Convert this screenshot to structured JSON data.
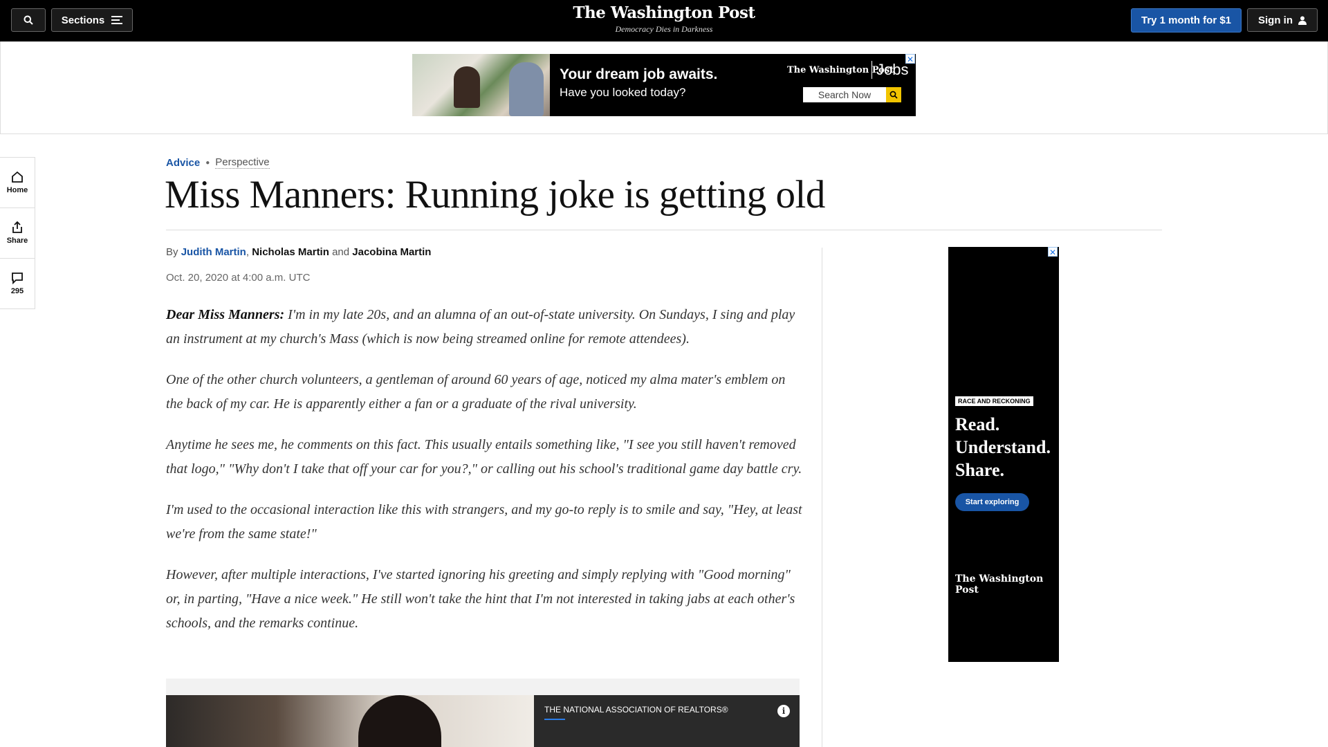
{
  "header": {
    "sections_label": "Sections",
    "logo": "The Washington Post",
    "tagline": "Democracy Dies in Darkness",
    "subscribe_label": "Try 1 month for $1",
    "signin_label": "Sign in"
  },
  "top_ad": {
    "headline": "Your dream job awaits.",
    "subline": "Have you looked today?",
    "brand": "The Washington Post",
    "brand_suffix": "Jobs",
    "search_label": "Search Now"
  },
  "rail": {
    "home": "Home",
    "share": "Share",
    "comments_count": "295"
  },
  "article": {
    "section": "Advice",
    "label": "Perspective",
    "headline": "Miss Manners: Running joke is getting old",
    "by": "By",
    "author1": "Judith Martin",
    "comma": ",",
    "author2": "Nicholas Martin",
    "and": "and",
    "author3": "Jacobina Martin",
    "date": "Oct. 20, 2020 at 4:00 a.m. UTC",
    "lead_in": "Dear Miss Manners:",
    "p1": "I'm in my late 20s, and an alumna of an out-of-state university. On Sundays, I sing and play an instrument at my church's Mass (which is now being streamed online for remote attendees).",
    "p2": "One of the other church volunteers, a gentleman of around 60 years of age, noticed my alma mater's emblem on the back of my car. He is apparently either a fan or a graduate of the rival university.",
    "p3": "Anytime he sees me, he comments on this fact. This usually entails something like, \"I see you still haven't removed that logo,\" \"Why don't I take that off your car for you?,\" or calling out his school's traditional game day battle cry.",
    "p4": "I'm used to the occasional interaction like this with strangers, and my go-to reply is to smile and say, \"Hey, at least we're from the same state!\"",
    "p5": "However, after multiple interactions, I've started ignoring his greeting and simply replying with \"Good morning\" or, in parting, \"Have a nice week.\" He still won't take the hint that I'm not interested in taking jabs at each other's schools, and the remarks continue."
  },
  "inline_ad": {
    "sponsor": "THE NATIONAL ASSOCIATION OF REALTORS®"
  },
  "side_ad": {
    "badge": "RACE AND RECKONING",
    "line1": "Read.",
    "line2": "Understand.",
    "line3": "Share.",
    "cta": "Start exploring",
    "logo": "The Washington Post"
  },
  "colors": {
    "accent_blue": "#1955a5",
    "topbar_bg": "#000000",
    "ad_yellow": "#f2c500"
  }
}
